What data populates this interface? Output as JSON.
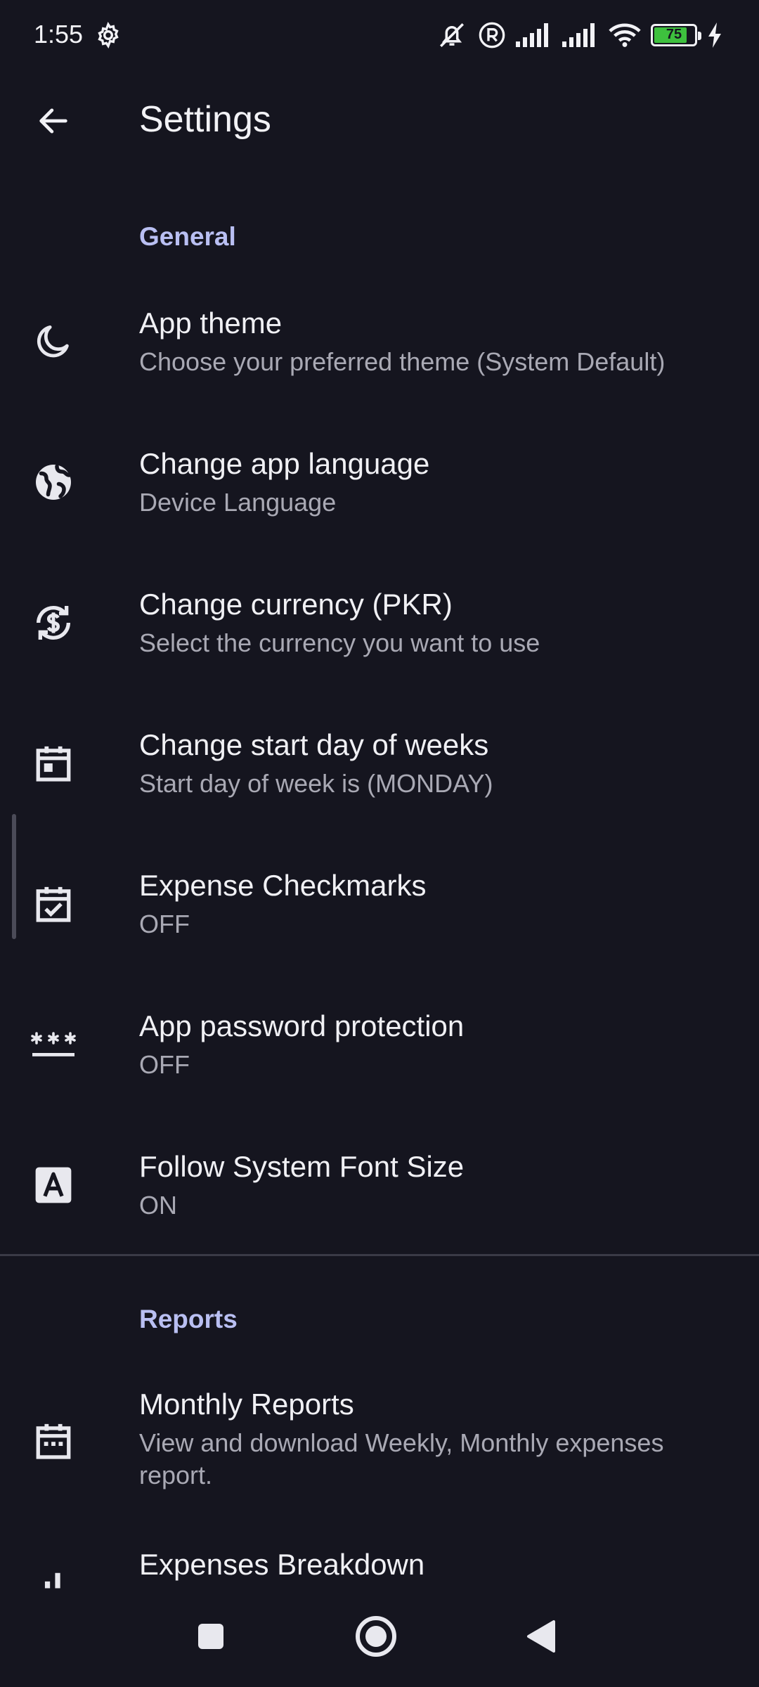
{
  "status_bar": {
    "time": "1:55",
    "battery_level": "75",
    "battery_fraction": 0.75,
    "accent_color": "#3ec13e",
    "icons": [
      "gear-icon",
      "mute-icon",
      "registered-icon",
      "signal-1-icon",
      "signal-2-icon",
      "wifi-icon",
      "battery-icon",
      "charging-icon"
    ]
  },
  "app_bar": {
    "title": "Settings",
    "back_icon": "arrow-left-icon"
  },
  "sections": {
    "general": {
      "title": "General"
    },
    "reports": {
      "title": "Reports"
    }
  },
  "settings": {
    "app_theme": {
      "title": "App theme",
      "subtitle": "Choose your preferred theme (System Default)",
      "icon": "moon-icon"
    },
    "language": {
      "title": "Change app language",
      "subtitle": "Device Language",
      "icon": "globe-icon"
    },
    "currency": {
      "title": "Change currency (PKR)",
      "subtitle": "Select the currency you want to use",
      "icon": "currency-exchange-icon"
    },
    "start_day": {
      "title": "Change start day of weeks",
      "subtitle": "Start day of week is (MONDAY)",
      "icon": "calendar-event-icon"
    },
    "checkmarks": {
      "title": "Expense Checkmarks",
      "subtitle": "OFF",
      "icon": "calendar-check-icon"
    },
    "password": {
      "title": "App password protection",
      "subtitle": "OFF",
      "icon": "password-icon"
    },
    "font_size": {
      "title": "Follow System Font Size",
      "subtitle": "ON",
      "icon": "font-icon"
    },
    "monthly_reports": {
      "title": "Monthly Reports",
      "subtitle": "View and download Weekly, Monthly expenses report.",
      "icon": "calendar-month-icon"
    },
    "breakdown": {
      "title": "Expenses Breakdown",
      "icon": "bar-chart-icon"
    }
  },
  "colors": {
    "background": "#15151f",
    "section_header": "#b9bff2",
    "title_text": "#f0f0f4",
    "subtitle_text": "#a9a9b4"
  },
  "nav_bar": {
    "icons": [
      "recents-square-icon",
      "home-circle-icon",
      "back-triangle-icon"
    ]
  }
}
